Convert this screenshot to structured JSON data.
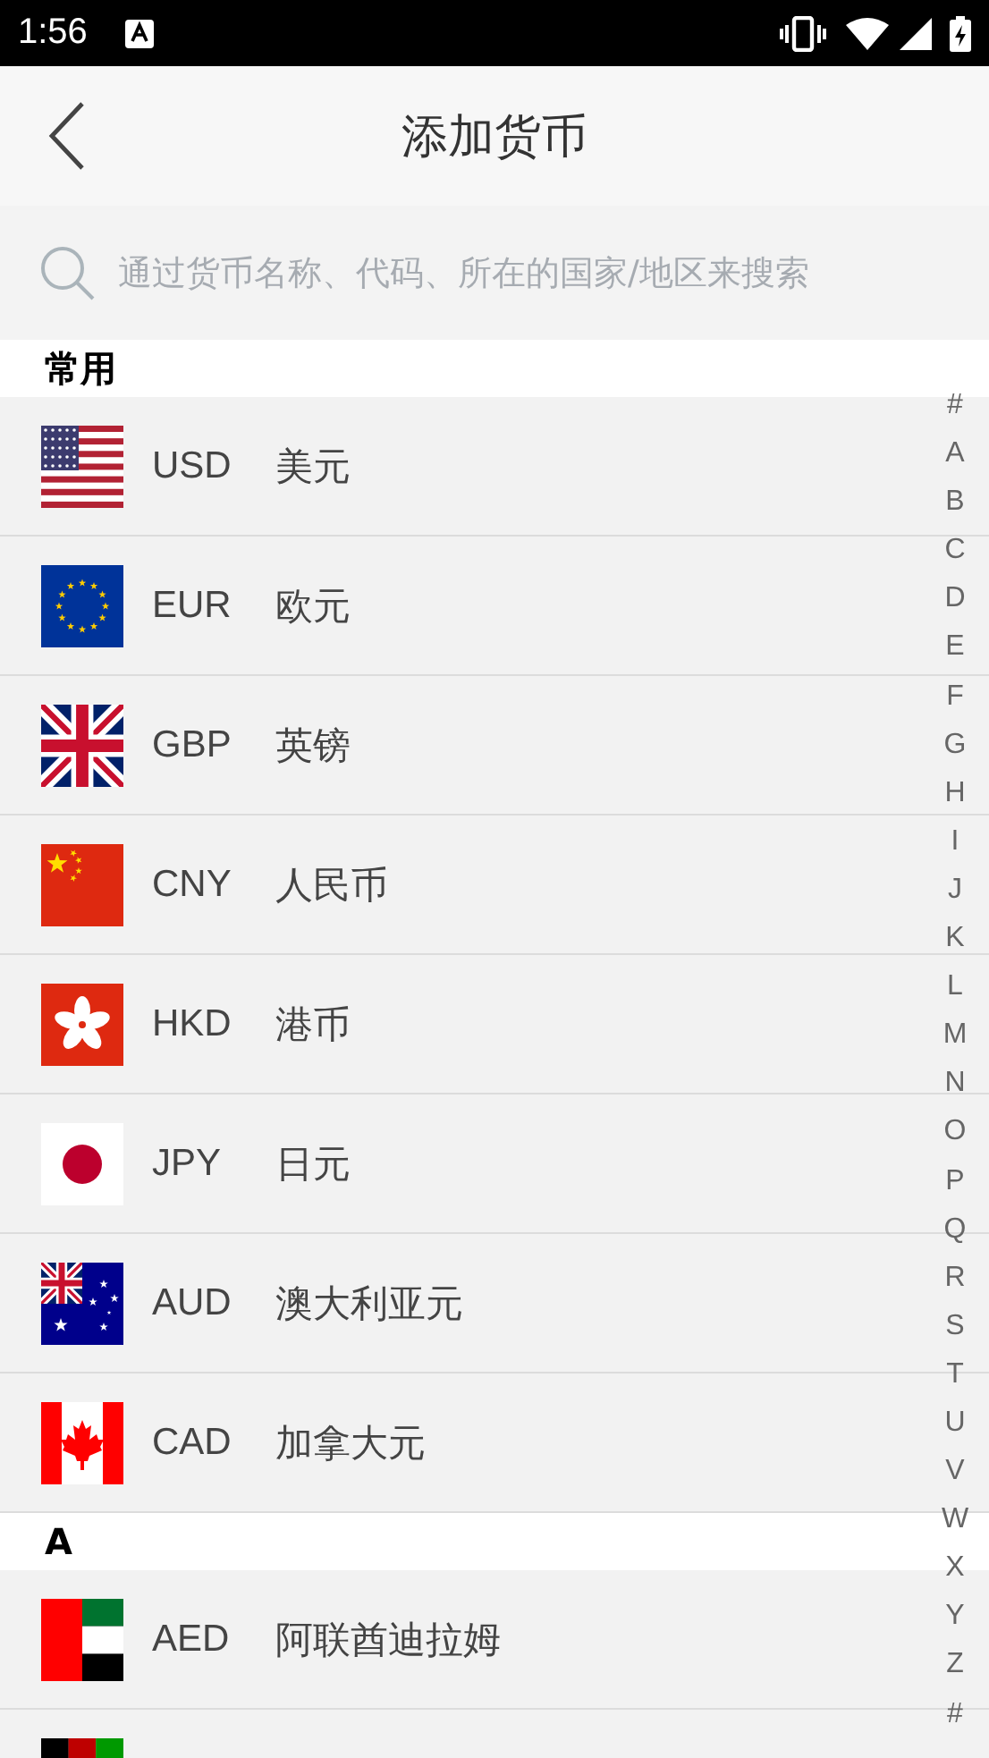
{
  "status_bar": {
    "time": "1:56"
  },
  "header": {
    "title": "添加货币"
  },
  "search": {
    "placeholder": "通过货币名称、代码、所在的国家/地区来搜索"
  },
  "sections": [
    {
      "heading": "常用",
      "items": [
        {
          "kind": "us",
          "code": "USD",
          "name": "美元"
        },
        {
          "kind": "eu",
          "code": "EUR",
          "name": "欧元"
        },
        {
          "kind": "gb",
          "code": "GBP",
          "name": "英镑"
        },
        {
          "kind": "cn",
          "code": "CNY",
          "name": "人民币"
        },
        {
          "kind": "hk",
          "code": "HKD",
          "name": "港币"
        },
        {
          "kind": "jp",
          "code": "JPY",
          "name": "日元"
        },
        {
          "kind": "au",
          "code": "AUD",
          "name": "澳大利亚元"
        },
        {
          "kind": "ca",
          "code": "CAD",
          "name": "加拿大元"
        }
      ]
    },
    {
      "heading": "A",
      "items": [
        {
          "kind": "ae",
          "code": "AED",
          "name": "阿联酋迪拉姆"
        },
        {
          "kind": "af"
        }
      ]
    }
  ],
  "index": [
    "#",
    "A",
    "B",
    "C",
    "D",
    "E",
    "F",
    "G",
    "H",
    "I",
    "J",
    "K",
    "L",
    "M",
    "N",
    "O",
    "P",
    "Q",
    "R",
    "S",
    "T",
    "U",
    "V",
    "W",
    "X",
    "Y",
    "Z",
    "#"
  ]
}
